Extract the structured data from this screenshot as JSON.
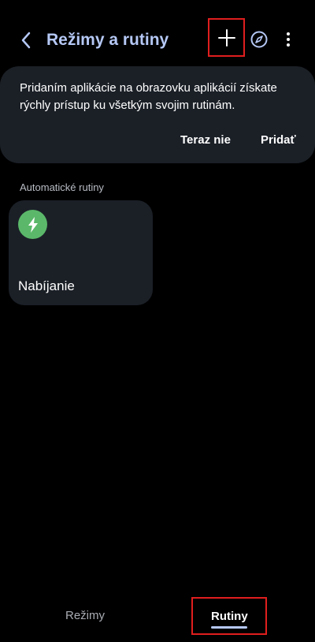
{
  "header": {
    "title": "Režimy a rutiny"
  },
  "banner": {
    "text": "Pridaním aplikácie na obrazovku aplikácií získate rýchly prístup ku všetkým svojim rutinám.",
    "later_label": "Teraz nie",
    "add_label": "Pridať"
  },
  "section": {
    "title": "Automatické rutiny"
  },
  "routines": [
    {
      "name": "Nabíjanie",
      "icon": "lightning-bolt-icon",
      "icon_color": "#5bb86a"
    }
  ],
  "bottom_nav": {
    "modes_label": "Režimy",
    "routines_label": "Rutiny",
    "active": "Rutiny"
  },
  "colors": {
    "accent": "#b5c8f5",
    "card_background": "#1b2027",
    "highlight_box": "#e01e1e"
  }
}
